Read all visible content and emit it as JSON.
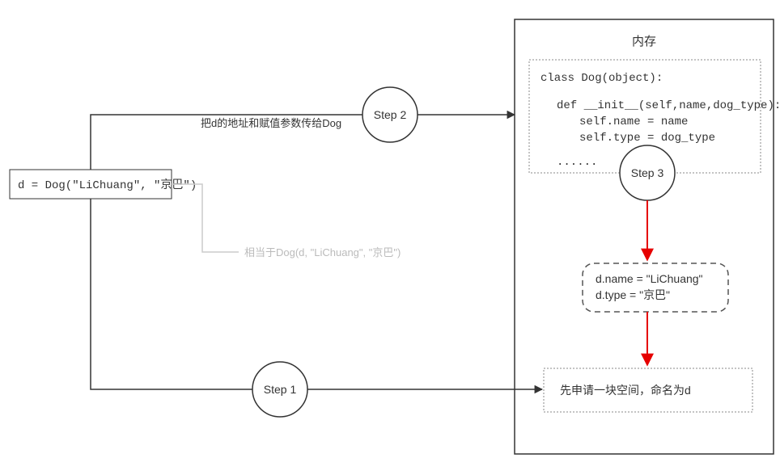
{
  "chart_data": {
    "type": "diagram",
    "nodes": [
      {
        "id": "source",
        "label": "d = Dog(\"LiChuang\", \"京巴\")"
      },
      {
        "id": "step1",
        "label": "Step 1"
      },
      {
        "id": "step2",
        "label": "Step 2"
      },
      {
        "id": "step3",
        "label": "Step 3"
      },
      {
        "id": "memory_title",
        "label": "内存"
      },
      {
        "id": "class_def",
        "lines": [
          "class Dog(object):",
          "    def __init__(self,name,dog_type):",
          "        self.name = name",
          "        self.type = dog_type",
          "    ......"
        ]
      },
      {
        "id": "attrs",
        "lines": [
          "d.name = \"LiChuang\"",
          "d.type = \"京巴\""
        ]
      },
      {
        "id": "alloc",
        "label": "先申请一块空间，命名为d"
      }
    ],
    "edges": [
      {
        "from": "source",
        "to": "step2",
        "label": "把d的地址和赋值参数传给Dog"
      },
      {
        "from": "source",
        "faded_label": "相当于Dog(d, \"LiChuang\", \"京巴\")"
      },
      {
        "from": "source",
        "to": "step1",
        "to2": "alloc"
      },
      {
        "from": "step3",
        "to": "attrs",
        "color": "red"
      },
      {
        "from": "attrs",
        "to": "alloc",
        "color": "red"
      }
    ]
  },
  "source_box": "d = Dog(\"LiChuang\", \"京巴\")",
  "label_top": "把d的地址和赋值参数传给Dog",
  "label_faded": "相当于Dog(d, \"LiChuang\", \"京巴\")",
  "step1": "Step 1",
  "step2": "Step 2",
  "step3": "Step 3",
  "memory_title": "内存",
  "class_line1": "class Dog(object):",
  "class_line2": "def __init__(self,name,dog_type):",
  "class_line3": "self.name = name",
  "class_line4": "self.type = dog_type",
  "class_line5": "......",
  "attr_line1": "d.name = \"LiChuang\"",
  "attr_line2": "d.type = \"京巴\"",
  "alloc_text": "先申请一块空间，命名为d"
}
